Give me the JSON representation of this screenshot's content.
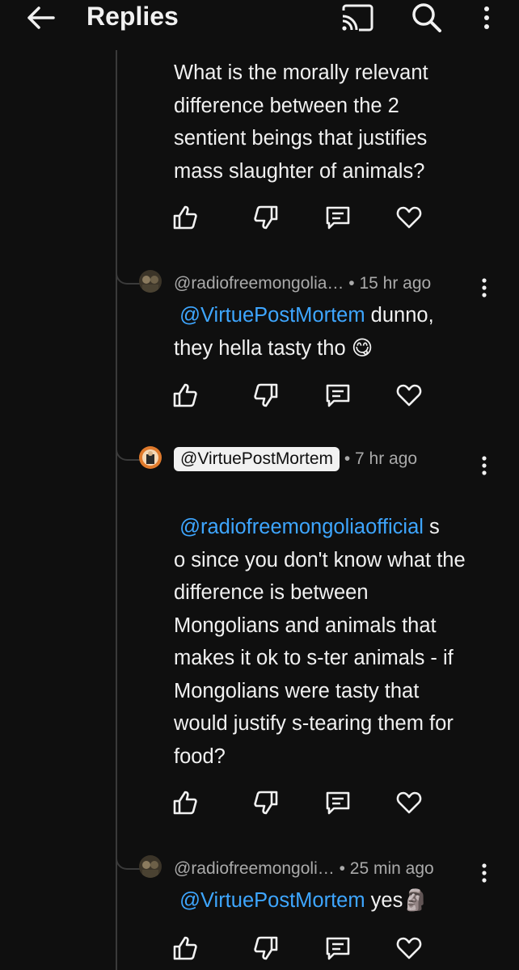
{
  "appbar": {
    "title": "Replies",
    "icons": [
      "back-arrow-icon",
      "cast-icon",
      "search-icon",
      "more-vert-icon"
    ]
  },
  "comments": [
    {
      "body": "What is the morally relevant difference between the 2 sentient beings that justifies mass slaughter of animals?"
    },
    {
      "author": "@radiofreemongolia…",
      "time": "• 15 hr ago",
      "mention": "@VirtuePostMortem",
      "text_after_mention": " dunno,",
      "text_line2": "they hella tasty tho",
      "emoji": "😋"
    },
    {
      "author": "@VirtuePostMortem",
      "author_highlighted": true,
      "time": "• 7 hr ago",
      "mention": "@radiofreemongoliaofficial",
      "text_after_mention": " s",
      "text_rest": "o since you don't know what the difference is between Mongolians and animals that makes it ok to s-ter animals - if Mongolians were tasty that would justify s-tearing them for food?"
    },
    {
      "author": "@radiofreemongoli…",
      "time": "• 25 min ago",
      "mention": "@VirtuePostMortem",
      "text_after_mention": " yes",
      "emoji": "🗿"
    }
  ],
  "actions": [
    "like-icon",
    "dislike-icon",
    "reply-icon",
    "heart-icon"
  ],
  "colors": {
    "background": "#0f0f0f",
    "text": "#f1f1f1",
    "secondary_text": "#aaaaaa",
    "mention": "#3ea6ff",
    "thread_line": "#3a3a3a"
  }
}
